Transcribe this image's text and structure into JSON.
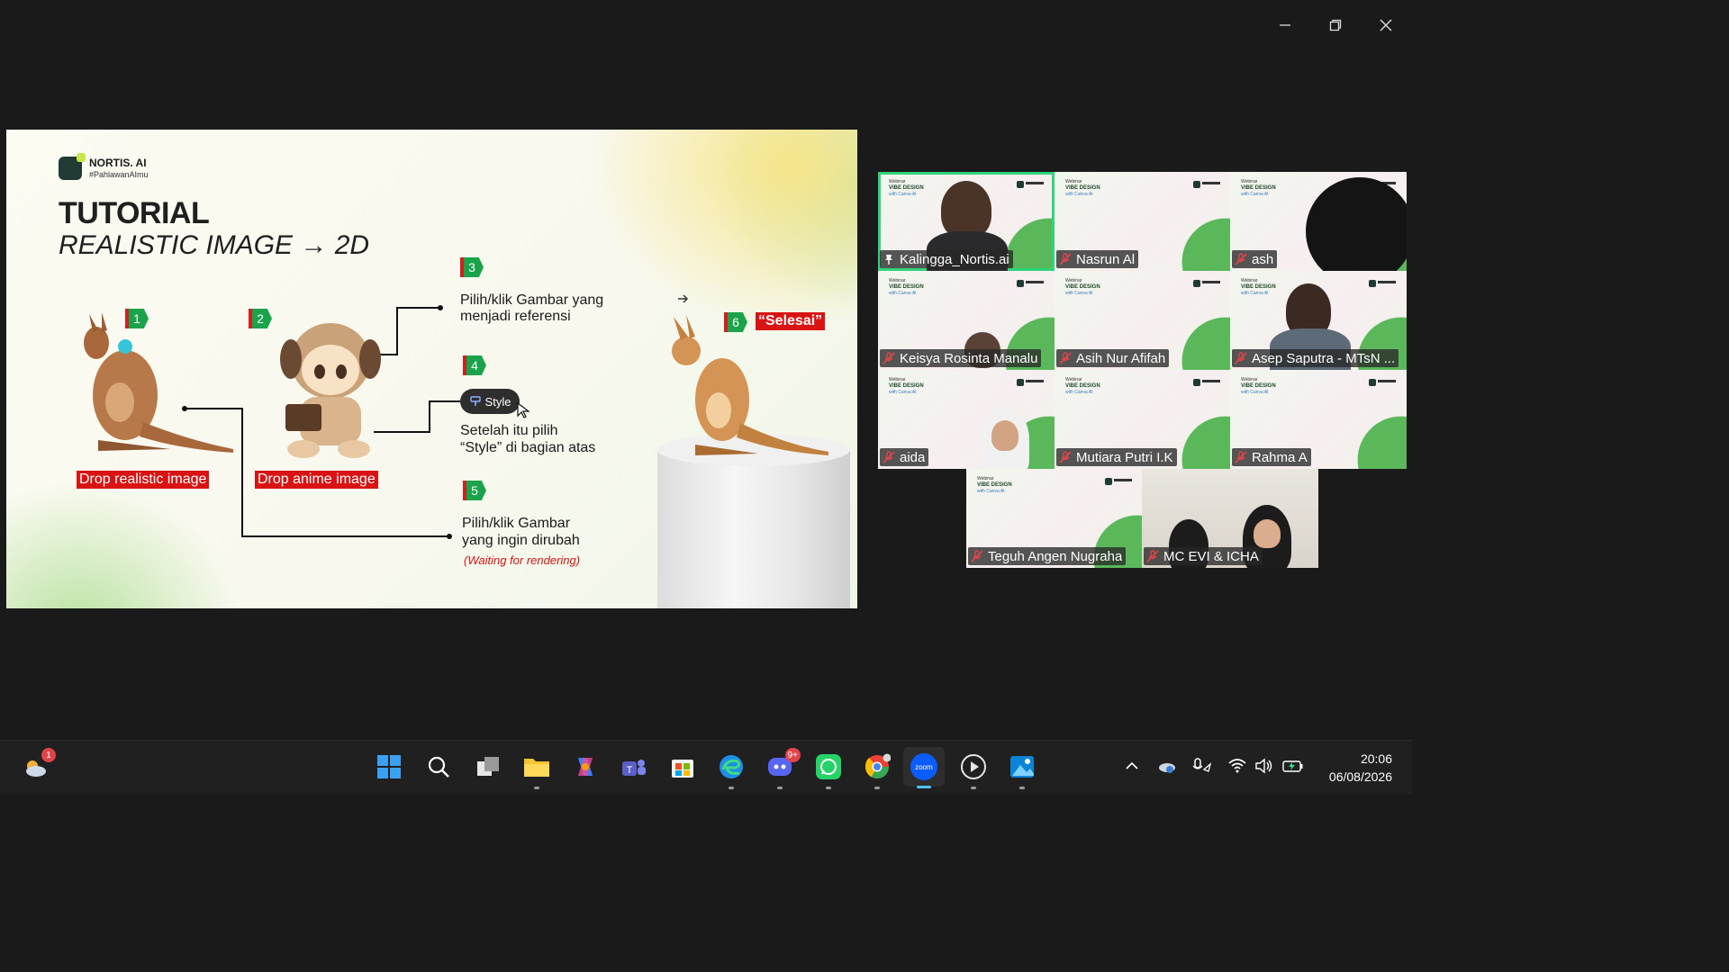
{
  "slide": {
    "logo_name": "NORTIS. AI",
    "logo_tag": "#PahlawanAImu",
    "title": "TUTORIAL",
    "subtitle": "REALISTIC IMAGE → 2D",
    "steps": {
      "s1": "1",
      "s2": "2",
      "s3": "3",
      "s4": "4",
      "s5": "5",
      "s6": "6"
    },
    "label_realistic": "Drop realistic image",
    "label_anime": "Drop anime image",
    "step3_text_1": "Pilih/klik Gambar yang",
    "step3_text_2": "menjadi referensi",
    "style_button": "Style",
    "step4_text_1": "Setelah itu pilih",
    "step4_text_2": "“Style” di bagian atas",
    "step5_text_1": "Pilih/klik Gambar",
    "step5_text_2": "yang ingin dirubah",
    "waiting": "(Waiting for rendering)",
    "selesai": "“Selesai”"
  },
  "tile_slide": {
    "line1": "Webinar",
    "line2": "VIBE DESIGN",
    "line3": "with Canva AI"
  },
  "participants": [
    {
      "name": "Kalingga_Nortis.ai"
    },
    {
      "name": "Nasrun Al"
    },
    {
      "name": "ash"
    },
    {
      "name": "Keisya Rosinta Manalu"
    },
    {
      "name": "Asih Nur Afifah"
    },
    {
      "name": "Asep Saputra - MTsN ..."
    },
    {
      "name": "aida"
    },
    {
      "name": "Mutiara Putri I.K"
    },
    {
      "name": "Rahma A"
    },
    {
      "name": "Teguh Angen Nugraha"
    },
    {
      "name": "MC EVI & ICHA"
    }
  ],
  "taskbar": {
    "weather_badge": "1",
    "discord_badge": "9+",
    "zoom_label": "zoom",
    "time": "20:06",
    "date": "06/08/2026"
  },
  "colors": {
    "active_speaker": "#2fd47a",
    "step_green": "#1aa34a",
    "label_red": "#d91313",
    "taskbar_accent": "#4cc2ff"
  }
}
